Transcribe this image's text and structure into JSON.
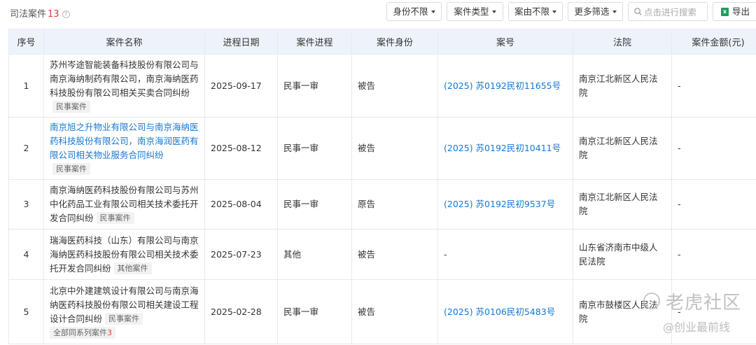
{
  "section": {
    "title": "司法案件",
    "count": "13",
    "help_icon": "question-circle-icon"
  },
  "filters": [
    {
      "label": "身份不限"
    },
    {
      "label": "案件类型"
    },
    {
      "label": "案由不限"
    },
    {
      "label": "更多筛选"
    }
  ],
  "search": {
    "placeholder": "点击进行搜索"
  },
  "export": {
    "label": "导出",
    "icon": "excel-icon"
  },
  "table": {
    "headers": [
      "序号",
      "案件名称",
      "进程日期",
      "案件进程",
      "案件身份",
      "案号",
      "法院",
      "案件金额(元)"
    ],
    "rows": [
      {
        "index": "1",
        "name": "苏州岑途智能装备科技股份有限公司与南京海纳制药有限公司，南京海纳医药科技股份有限公司相关买卖合同纠纷",
        "name_link": false,
        "tag": "民事案件",
        "date": "2025-09-17",
        "stage": "民事一审",
        "role": "被告",
        "case_no": "(2025) 苏0192民初11655号",
        "court": "南京江北新区人民法院",
        "amount": "-"
      },
      {
        "index": "2",
        "name": "南京旭之升物业有限公司与南京海纳医药科技股份有限公司，南京海润医药有限公司相关物业服务合同纠纷",
        "name_link": true,
        "tag": "民事案件",
        "date": "2025-08-12",
        "stage": "民事一审",
        "role": "被告",
        "case_no": "(2025) 苏0192民初10411号",
        "court": "南京江北新区人民法院",
        "amount": "-"
      },
      {
        "index": "3",
        "name": "南京海纳医药科技股份有限公司与苏州中化药品工业有限公司相关技术委托开发合同纠纷",
        "name_link": false,
        "tag": "民事案件",
        "date": "2025-08-04",
        "stage": "民事一审",
        "role": "原告",
        "case_no": "(2025) 苏0192民初9537号",
        "court": "南京江北新区人民法院",
        "amount": "-"
      },
      {
        "index": "4",
        "name": "瑞海医药科技（山东）有限公司与南京海纳医药科技股份有限公司相关技术委托开发合同纠纷",
        "name_link": false,
        "tag": "其他案件",
        "date": "2025-07-23",
        "stage": "其他",
        "role": "被告",
        "case_no": "-",
        "court": "山东省济南市中级人民法院",
        "amount": "-"
      },
      {
        "index": "5",
        "name": "北京中外建建筑设计有限公司与南京海纳医药科技股份有限公司相关建设工程设计合同纠纷",
        "name_link": false,
        "tag": "民事案件",
        "series_label": "全部同系列案件",
        "series_count": "3",
        "date": "2025-02-28",
        "stage": "民事一审",
        "role": "被告",
        "case_no": "(2025) 苏0106民初5483号",
        "court": "南京市鼓楼区人民法院",
        "amount": "-"
      }
    ]
  },
  "watermark": {
    "main": "老虎社区",
    "sub": "@创业最前线"
  },
  "colors": {
    "header_bg": "#eef3fb",
    "link": "#1677d2",
    "count": "#e4393c",
    "tag_bg": "#f2f2f2"
  }
}
